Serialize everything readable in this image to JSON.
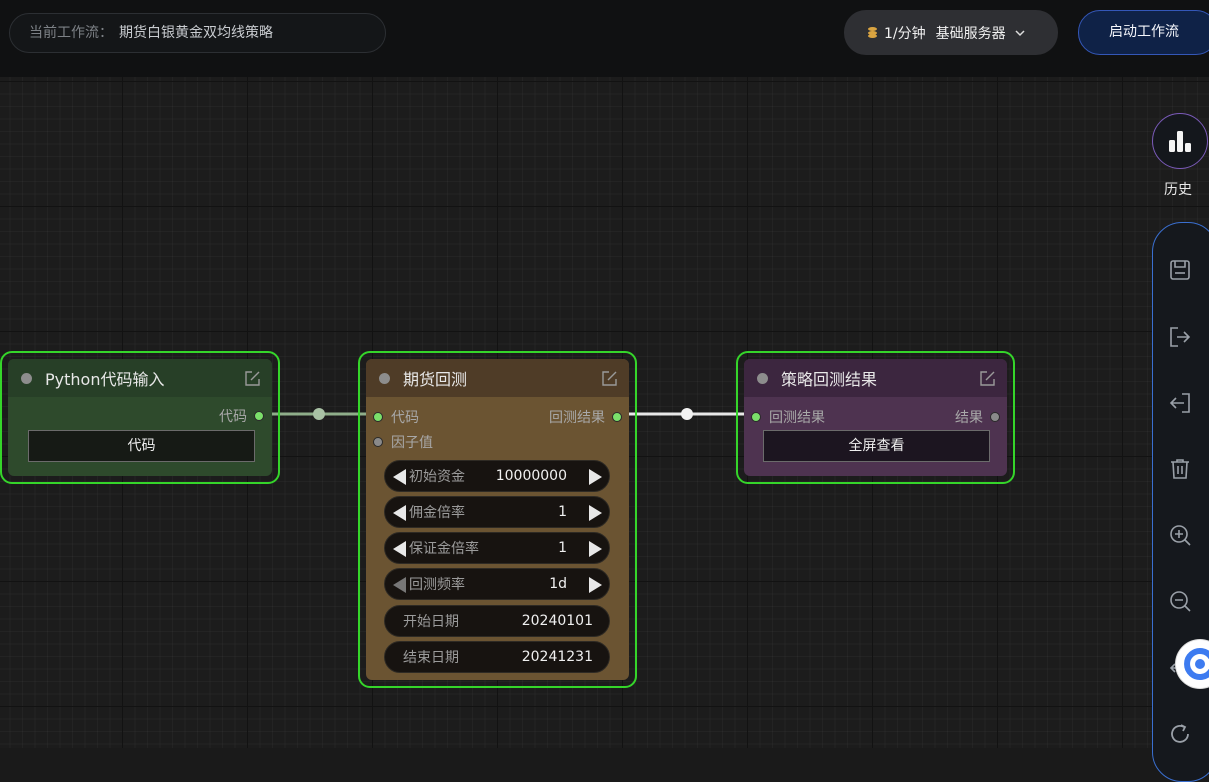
{
  "header": {
    "workflow_prefix": "当前工作流：",
    "workflow_name": "期货白银黄金双均线策略",
    "rate": "1/分钟",
    "server": "基础服务器",
    "start_label": "启动工作流"
  },
  "nodes": {
    "python_input": {
      "title": "Python代码输入",
      "output_code": "代码",
      "code_button": "代码"
    },
    "backtest": {
      "title": "期货回测",
      "input_code": "代码",
      "output_result": "回测结果",
      "input_factor": "因子值",
      "params": [
        {
          "label": "初始资金",
          "value": "10000000"
        },
        {
          "label": "佣金倍率",
          "value": "1"
        },
        {
          "label": "保证金倍率",
          "value": "1"
        },
        {
          "label": "回测频率",
          "value": "1d"
        }
      ],
      "start_date_label": "开始日期",
      "start_date_value": "20240101",
      "end_date_label": "结束日期",
      "end_date_value": "20241231"
    },
    "result": {
      "title": "策略回测结果",
      "input_result": "回测结果",
      "output_result": "结果",
      "fullscreen_button": "全屏查看"
    }
  },
  "sidebar": {
    "history_label": "历史",
    "tools": [
      "save-icon",
      "export-icon",
      "import-icon",
      "delete-icon",
      "zoom-in-icon",
      "zoom-out-icon",
      "fit-view-icon",
      "refresh-icon"
    ]
  },
  "colors": {
    "node_border": "#35d52a",
    "python_node_bg": "#2e4a2c",
    "backtest_node_bg": "#6b5432",
    "result_node_bg": "#4e3350",
    "accent_blue": "#3457b8"
  }
}
